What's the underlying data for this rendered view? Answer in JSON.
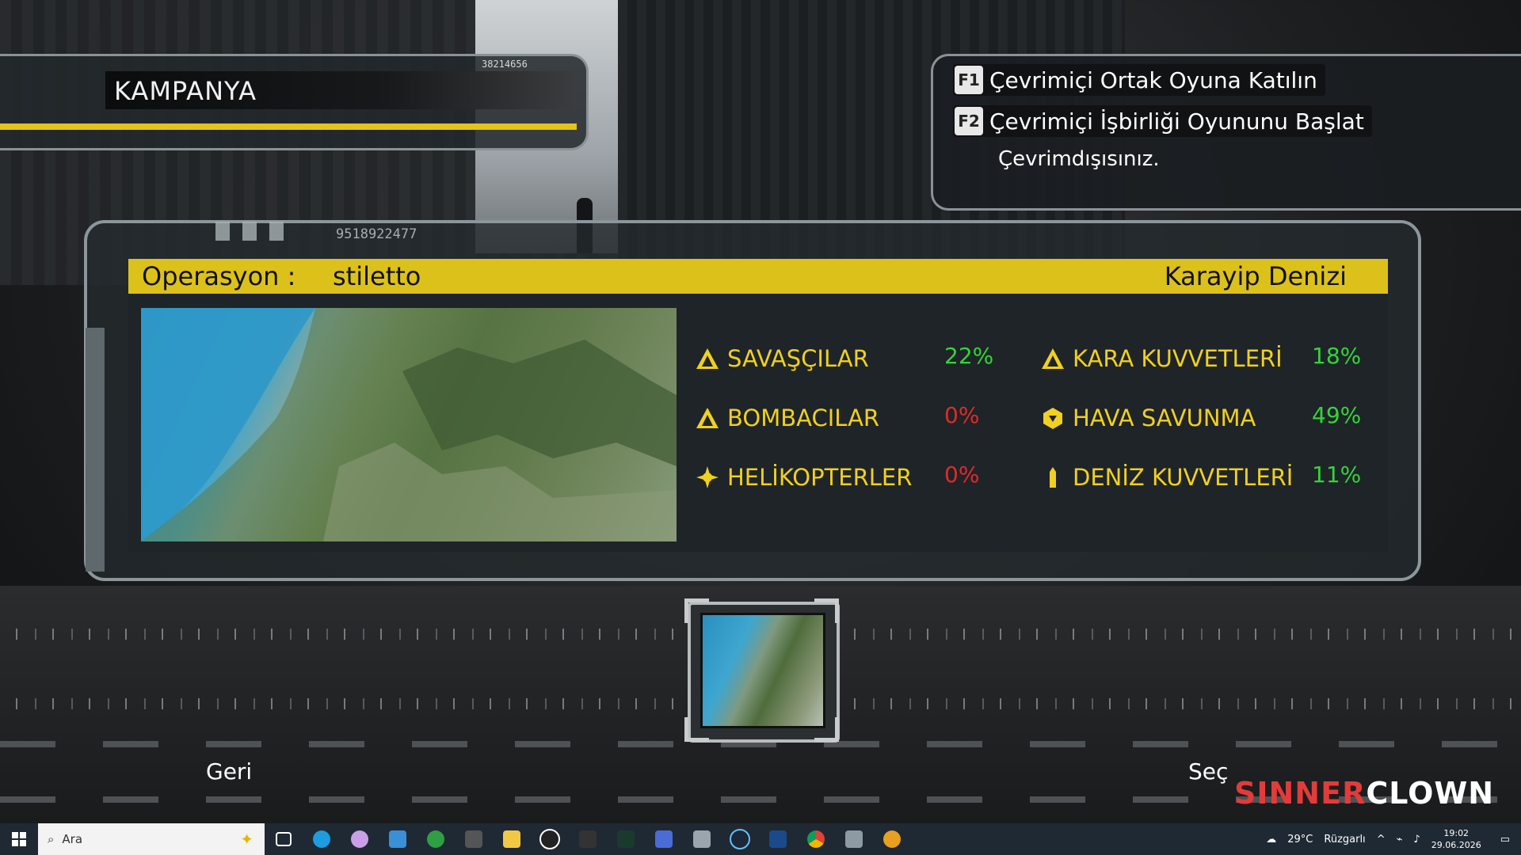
{
  "campaign": {
    "id_number": "38214656",
    "title": "KAMPANYA"
  },
  "online": {
    "options": [
      {
        "key": "F1",
        "label": "Çevrimiçi Ortak Oyuna Katılın"
      },
      {
        "key": "F2",
        "label": "Çevrimiçi İşbirliği Oyununu Başlat"
      }
    ],
    "status": "Çevrimdışısınız."
  },
  "mission": {
    "id_number": "9518922477",
    "operation_label": "Operasyon :",
    "operation_name": "stiletto",
    "region": "Karayip Denizi",
    "stats": [
      {
        "label": "SAVAŞÇILAR",
        "value": "22%",
        "icon": "warning-triangle-icon",
        "color": "#34d43a"
      },
      {
        "label": "BOMBACILAR",
        "value": "0%",
        "icon": "warning-triangle-icon",
        "color": "#e02a2a"
      },
      {
        "label": "HELİKOPTERLER",
        "value": "0%",
        "icon": "rotor-icon",
        "color": "#e02a2a"
      },
      {
        "label": "KARA KUVVETLERİ",
        "value": "18%",
        "icon": "warning-triangle-icon",
        "color": "#34d43a"
      },
      {
        "label": "HAVA SAVUNMA",
        "value": "49%",
        "icon": "hexagon-icon",
        "color": "#34d43a"
      },
      {
        "label": "DENİZ KUVVETLERİ",
        "value": "11%",
        "icon": "ship-icon",
        "color": "#34d43a"
      }
    ]
  },
  "navigation": {
    "back_label": "Geri",
    "select_label": "Seç"
  },
  "watermark": {
    "part1": "SINNER",
    "part2": "CLOWN"
  },
  "taskbar": {
    "search_placeholder": "Ara",
    "weather": "29°C",
    "weather_text": "Rüzgarlı",
    "time": "19:02",
    "date": "29.06.2026"
  },
  "colors": {
    "accent_yellow": "#dcc11b",
    "value_green": "#34d43a",
    "value_red": "#e02a2a"
  }
}
